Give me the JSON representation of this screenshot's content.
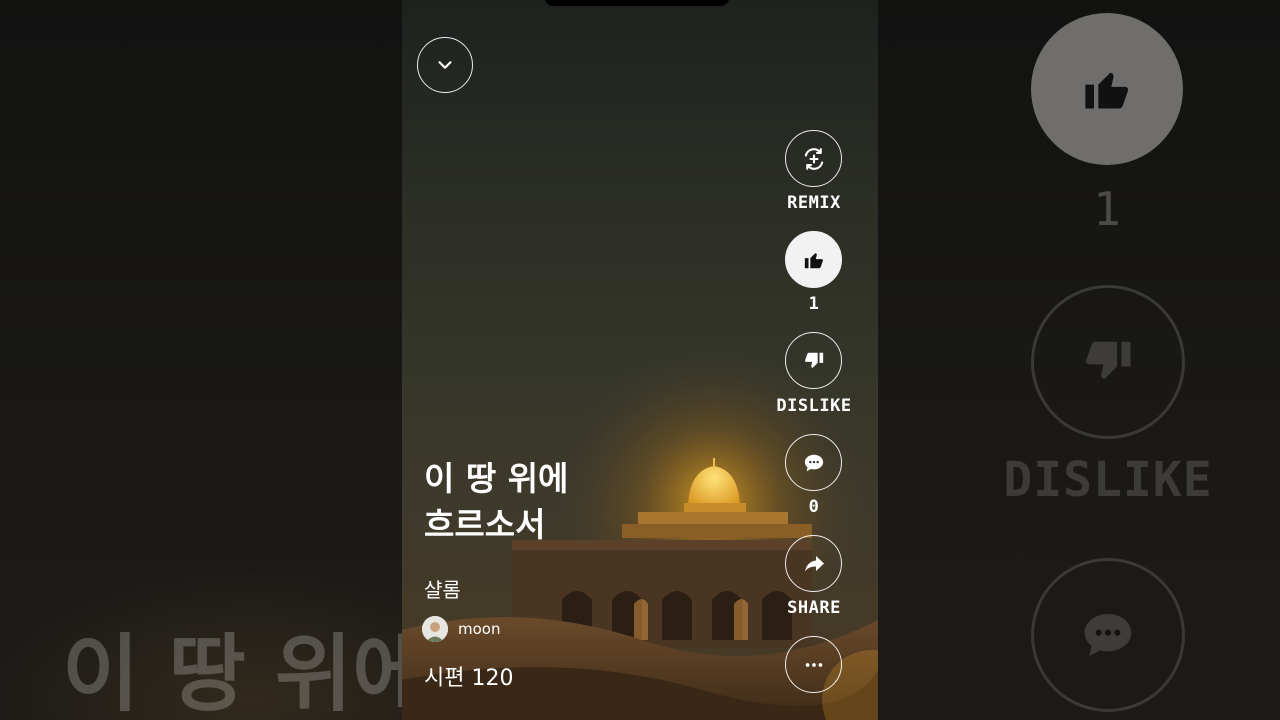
{
  "video": {
    "title_line1": "이 땅 위에",
    "title_line2": "흐르소서",
    "subtitle": "샬롬",
    "author": "moon",
    "views": "시편 120"
  },
  "actions": {
    "remix_label": "REMIX",
    "like_count": "1",
    "dislike_label": "DISLIKE",
    "comment_count": "0",
    "share_label": "SHARE"
  },
  "backdrop": {
    "title_fragment": "이 땅 위에",
    "like_count": "1",
    "dislike_label": "DISLIKE"
  },
  "icons": {
    "collapse": "chevron-down-icon",
    "remix": "remix-icon",
    "like": "thumbs-up-icon",
    "dislike": "thumbs-down-icon",
    "comment": "comment-icon",
    "share": "share-arrow-icon",
    "more": "more-icon"
  },
  "colors": {
    "like_active_bg": "#f2f2f2",
    "sun_glow": "#f5b21e"
  }
}
